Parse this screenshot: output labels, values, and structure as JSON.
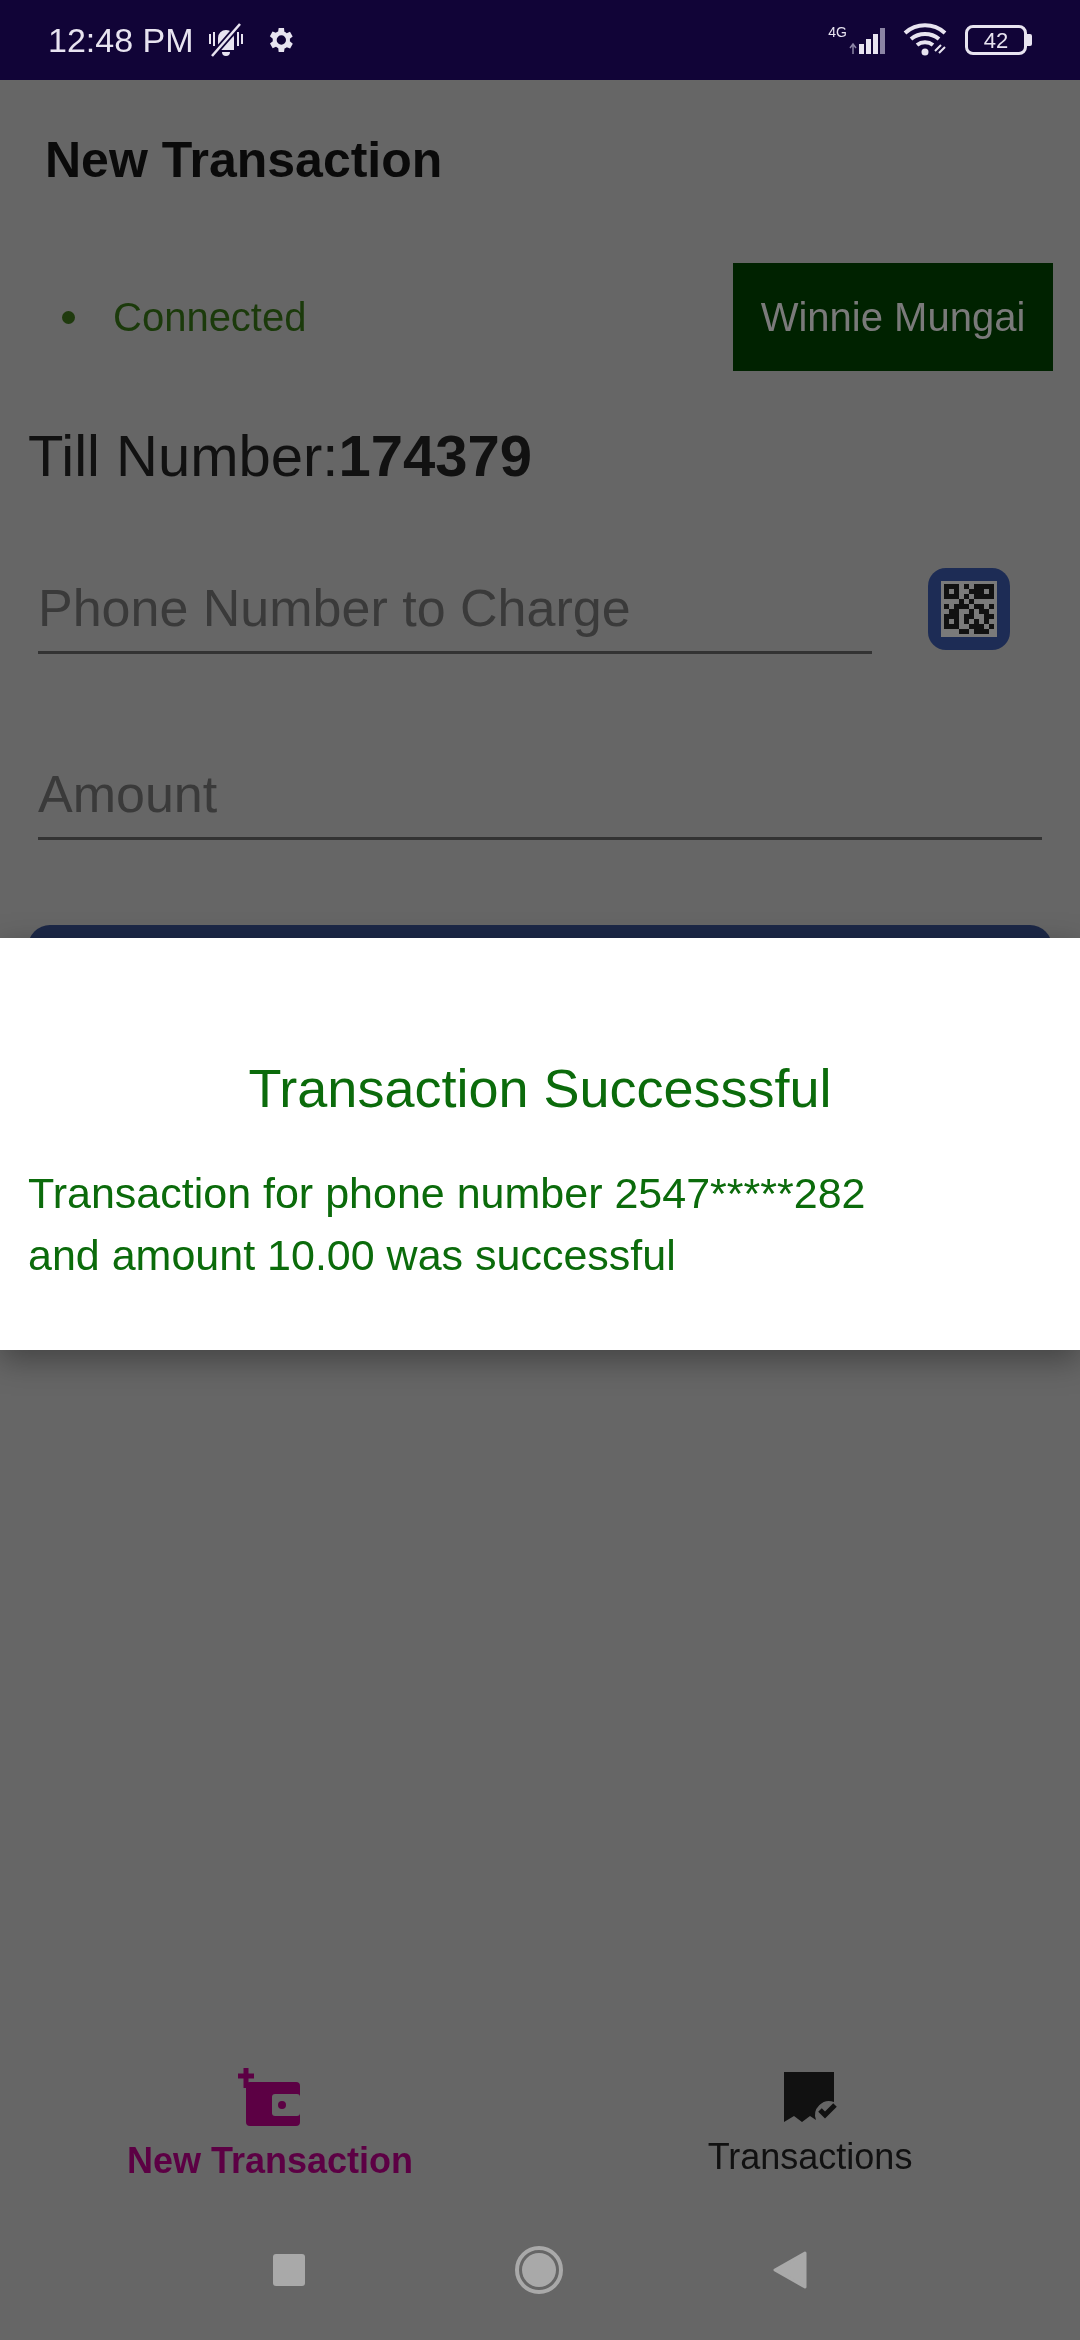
{
  "status_bar": {
    "time": "12:48 PM",
    "network": "4G",
    "battery": "42"
  },
  "app_bar": {
    "title": "New Transaction"
  },
  "connection": {
    "label": "Connected"
  },
  "user_button": {
    "label": "Winnie Mungai"
  },
  "till": {
    "label": "Till Number:",
    "value": "174379"
  },
  "fields": [
    {
      "placeholder": "Phone Number to Charge",
      "scan": true
    },
    {
      "placeholder": "Amount",
      "scan": false
    }
  ],
  "dialog": {
    "title": "Transaction Successsful",
    "message": "Transaction for phone number 2547*****282 and amount 10.00 was successful"
  },
  "bottom_nav": [
    {
      "label": "New Transaction",
      "kind": "new",
      "selected": true
    },
    {
      "label": "Transactions",
      "kind": "list",
      "selected": false
    }
  ]
}
